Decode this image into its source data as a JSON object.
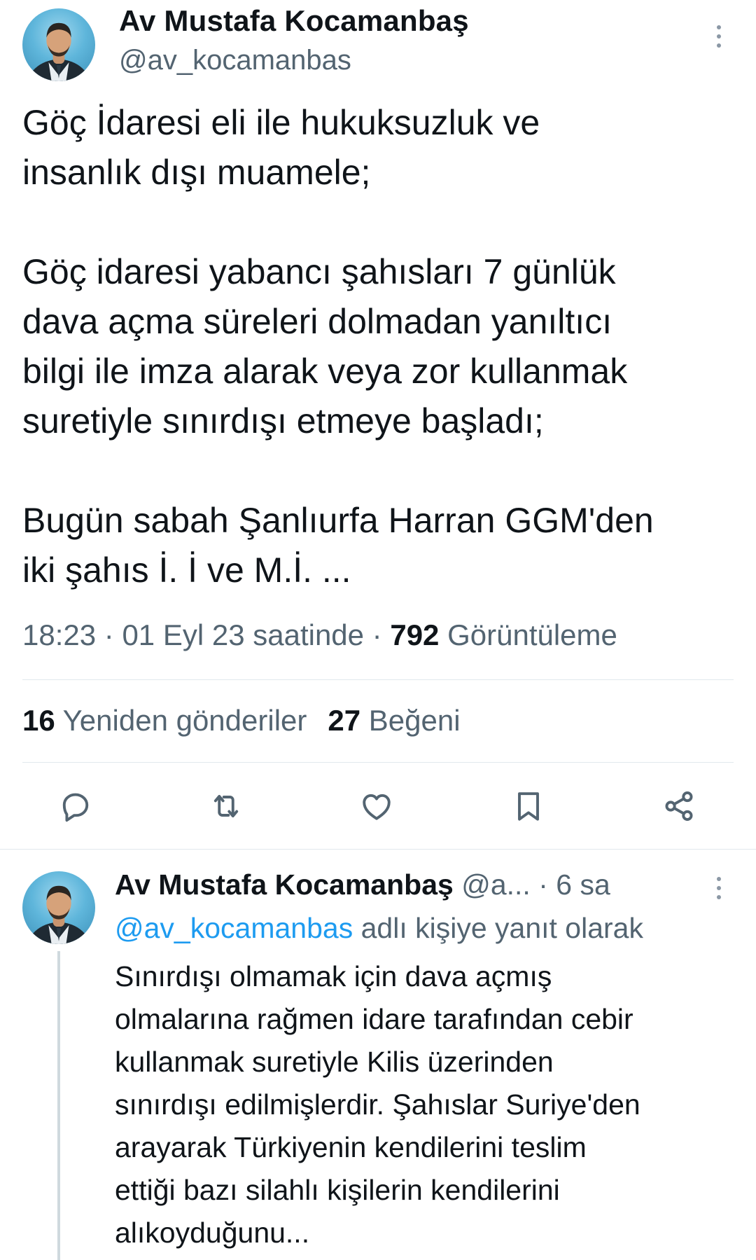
{
  "main_tweet": {
    "author_name": "Av Mustafa Kocamanbaş",
    "author_handle": "@av_kocamanbas",
    "text": "Göç İdaresi eli ile hukuksuzluk ve\ninsanlık dışı muamele;\n\nGöç idaresi yabancı şahısları 7 günlük\ndava açma süreleri dolmadan yanıltıcı\nbilgi ile imza alarak veya zor kullanmak\nsuretiyle sınırdışı etmeye başladı;\n\nBugün sabah Şanlıurfa Harran GGM'den\niki şahıs İ. İ ve M.İ. ...",
    "time": "18:23",
    "separator": " · ",
    "date": "01 Eyl 23 saatinde",
    "views_count": "792",
    "views_label": "Görüntüleme",
    "retweets_count": "16",
    "retweets_label": "Yeniden gönderiler",
    "likes_count": "27",
    "likes_label": "Beğeni"
  },
  "actions": {
    "icons": [
      "reply-icon",
      "retweet-icon",
      "like-icon",
      "bookmark-icon",
      "share-icon"
    ]
  },
  "reply_tweet": {
    "author_name": "Av Mustafa Kocamanbaş",
    "author_handle": "@a...",
    "time": "· 6 sa",
    "reply_to_mention": "@av_kocamanbas",
    "reply_to_suffix": "adlı kişiye yanıt olarak",
    "text": "Sınırdışı olmamak için dava açmış\nolmalarına rağmen idare tarafından cebir\nkullanmak suretiyle Kilis üzerinden\nsınırdışı edilmişlerdir. Şahıslar Suriye'den\narayarak Türkiyenin kendilerini teslim\nettiği bazı silahlı kişilerin kendilerini\nalıkoyduğunu..."
  },
  "colors": {
    "text_primary": "#0f1419",
    "text_secondary": "#536471",
    "link": "#1d9bf0",
    "divider": "#e1e8ed"
  }
}
